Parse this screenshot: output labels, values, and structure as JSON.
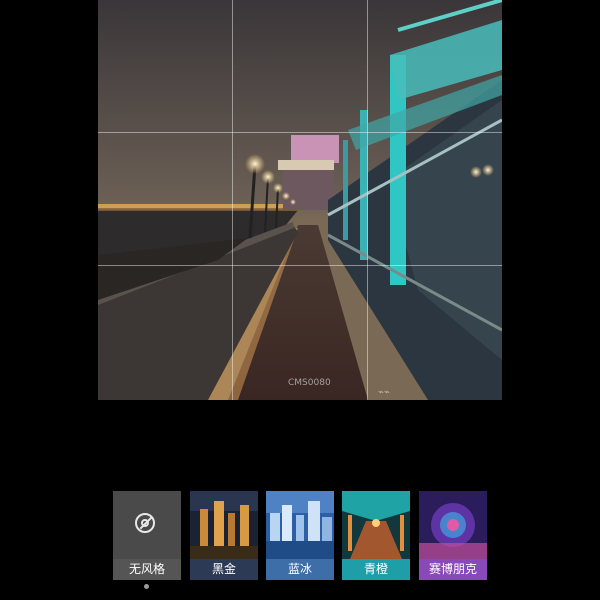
{
  "editor": {
    "photo_description_icon": "night-pier-photo",
    "grid_overlay": "rule-of-thirds"
  },
  "filters": [
    {
      "label": "无风格",
      "icon": "no-filter-icon",
      "selected": true,
      "label_bg": "#555555"
    },
    {
      "label": "黑金",
      "icon": "black-gold-thumbnail",
      "selected": false,
      "label_bg": "#2d3a55"
    },
    {
      "label": "蓝冰",
      "icon": "blue-ice-thumbnail",
      "selected": false,
      "label_bg": "#3d6ea8"
    },
    {
      "label": "青橙",
      "icon": "teal-orange-thumbnail",
      "selected": false,
      "label_bg": "#1e9fa8"
    },
    {
      "label": "赛博朋克",
      "icon": "cyberpunk-thumbnail",
      "selected": false,
      "label_bg": "#8a49b8"
    }
  ]
}
